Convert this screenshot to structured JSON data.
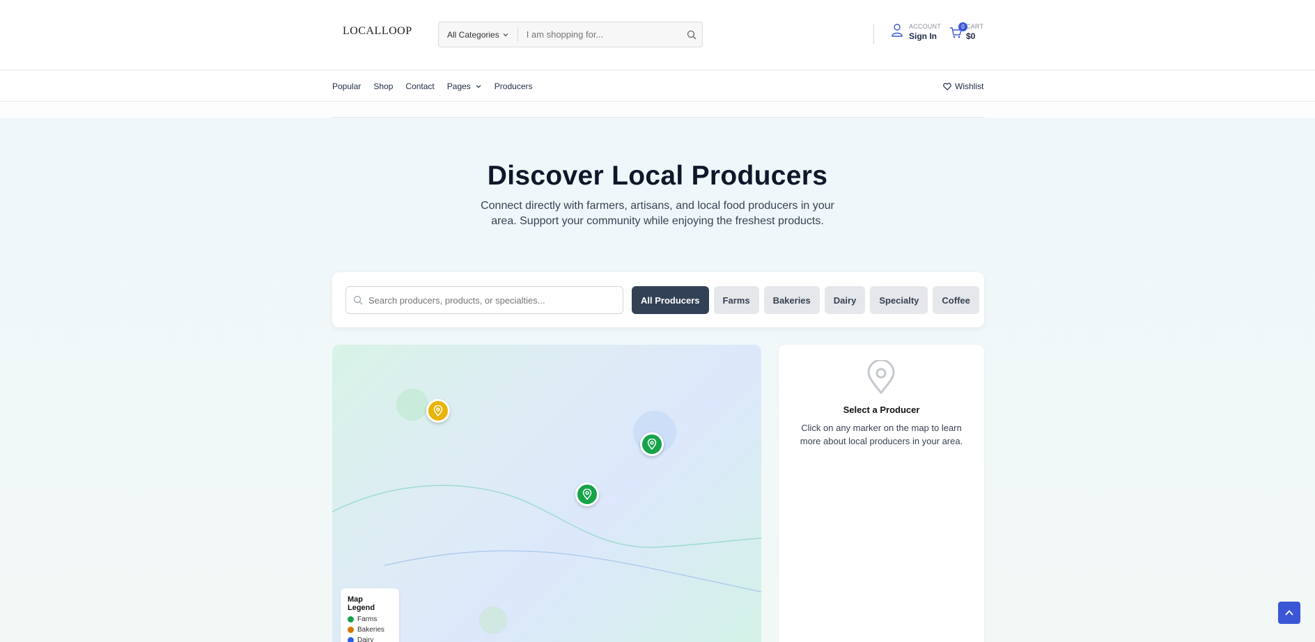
{
  "header": {
    "logo": "LOCALLOOP",
    "category_select": "All Categories",
    "search_placeholder": "I am shopping for...",
    "account_label": "ACCOUNT",
    "signin_label": "Sign In",
    "cart_label": "CART",
    "cart_total": "$0",
    "cart_count": "0"
  },
  "nav": {
    "items": [
      "Popular",
      "Shop",
      "Contact",
      "Pages",
      "Producers"
    ],
    "wishlist": "Wishlist"
  },
  "hero": {
    "title": "Discover Local Producers",
    "subtitle": "Connect directly with farmers, artisans, and local food producers in your area. Support your community while enjoying the freshest products."
  },
  "filter": {
    "search_placeholder": "Search producers, products, or specialties...",
    "chips": [
      "All Producers",
      "Farms",
      "Bakeries",
      "Dairy",
      "Specialty",
      "Coffee"
    ],
    "active_chip": "All Producers"
  },
  "map": {
    "legend_title": "Map Legend",
    "legend": [
      {
        "label": "Farms",
        "color": "#16a34a"
      },
      {
        "label": "Bakeries",
        "color": "#d97706"
      },
      {
        "label": "Dairy",
        "color": "#2563eb"
      }
    ]
  },
  "info_panel": {
    "title": "Select a Producer",
    "description": "Click on any marker on the map to learn more about local producers in your area."
  },
  "colors": {
    "accent": "#3b57d6",
    "active_chip": "#334155",
    "farm_pin": "#16a34a",
    "bakery_pin": "#eab308"
  }
}
